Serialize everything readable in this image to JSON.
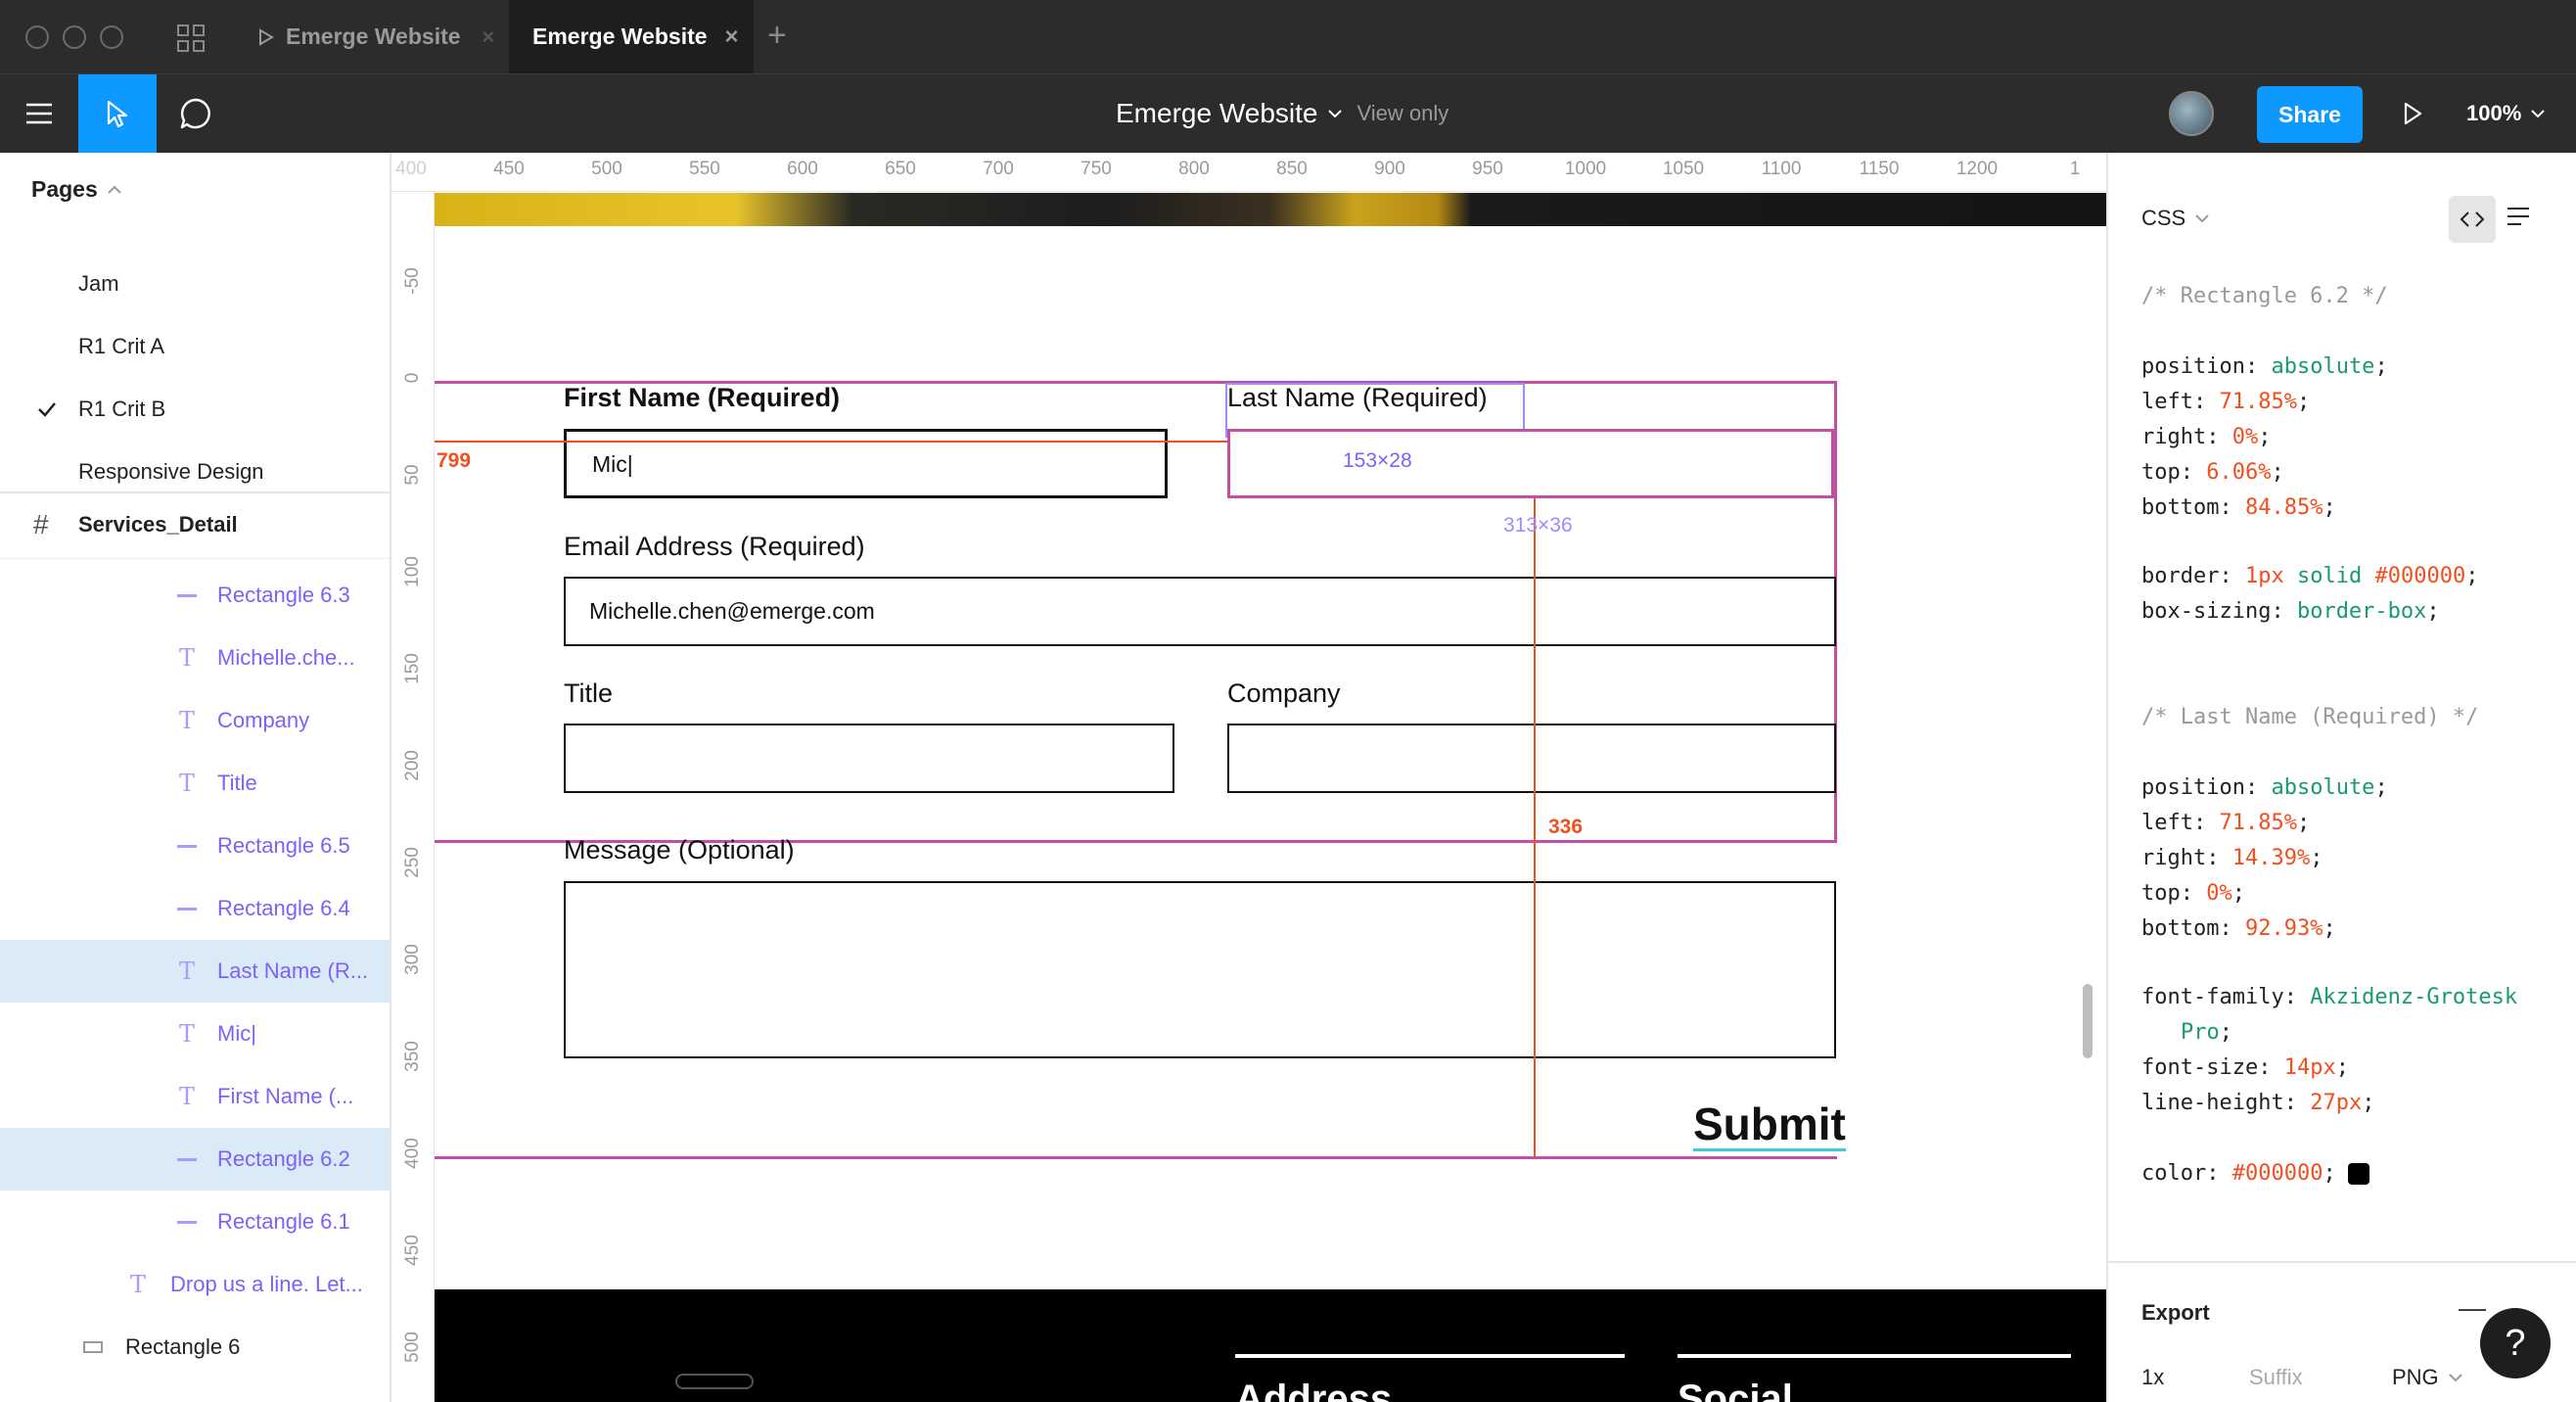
{
  "titlebar": {
    "tabs": [
      {
        "label": "Emerge Website",
        "active": false
      },
      {
        "label": "Emerge Website",
        "active": true
      }
    ]
  },
  "toolbar": {
    "file_name": "Emerge Website",
    "mode": "View only",
    "share_label": "Share",
    "zoom": "100%"
  },
  "pages": {
    "header": "Pages",
    "items": [
      {
        "label": "Jam",
        "current": false
      },
      {
        "label": "R1 Crit A",
        "current": false
      },
      {
        "label": "R1 Crit B",
        "current": true
      },
      {
        "label": "Responsive Design",
        "current": false
      }
    ]
  },
  "layers": {
    "frame": "Services_Detail",
    "items": [
      {
        "label": "Rectangle 6.3",
        "type": "line",
        "selected": false
      },
      {
        "label": "Michelle.che...",
        "type": "text",
        "selected": false
      },
      {
        "label": "Company",
        "type": "text",
        "selected": false
      },
      {
        "label": "Title",
        "type": "text",
        "selected": false
      },
      {
        "label": "Rectangle 6.5",
        "type": "line",
        "selected": false
      },
      {
        "label": "Rectangle 6.4",
        "type": "line",
        "selected": false
      },
      {
        "label": "Last Name (R...",
        "type": "text",
        "selected": true
      },
      {
        "label": "Mic|",
        "type": "text",
        "selected": false
      },
      {
        "label": "First Name (...",
        "type": "text",
        "selected": false
      },
      {
        "label": "Rectangle 6.2",
        "type": "line",
        "selected": true
      },
      {
        "label": "Rectangle 6.1",
        "type": "line",
        "selected": false
      },
      {
        "label": "Drop us a line. Let...",
        "type": "text",
        "selected": false
      },
      {
        "label": "Rectangle 6",
        "type": "rect",
        "selected": false
      }
    ]
  },
  "ruler_top": [
    "400",
    "450",
    "500",
    "550",
    "600",
    "650",
    "700",
    "750",
    "800",
    "850",
    "900",
    "950",
    "1000",
    "1050",
    "1100",
    "1150",
    "1200",
    "1"
  ],
  "ruler_left": [
    "-50",
    "0",
    "50",
    "100",
    "150",
    "200",
    "250",
    "300",
    "350",
    "400",
    "450",
    "500"
  ],
  "form": {
    "first_name_label": "First Name (Required)",
    "first_name_value": "Mic|",
    "last_name_label": "Last Name (Required)",
    "email_label": "Email Address (Required)",
    "email_value": "Michelle.chen@emerge.com",
    "title_label": "Title",
    "company_label": "Company",
    "message_label": "Message (Optional)",
    "submit_label": "Submit"
  },
  "footer": {
    "address_heading": "Address",
    "social_heading": "Social"
  },
  "measurements": {
    "dim_text": "153×28",
    "dim_rect": "313×36",
    "distance_left": "799",
    "distance_bottom": "336"
  },
  "inspect": {
    "tab": "CSS",
    "block1_comment": "/* Rectangle 6.2 */",
    "block1": [
      {
        "prop": "position",
        "val": "absolute",
        "kind": "kw"
      },
      {
        "prop": "left",
        "val": "71.85%",
        "kind": "num"
      },
      {
        "prop": "right",
        "val": "0%",
        "kind": "num"
      },
      {
        "prop": "top",
        "val": "6.06%",
        "kind": "num"
      },
      {
        "prop": "bottom",
        "val": "84.85%",
        "kind": "num"
      }
    ],
    "block1b": [
      {
        "prop": "border",
        "val": "1px solid #000000",
        "kind": "mixed"
      },
      {
        "prop": "box-sizing",
        "val": "border-box",
        "kind": "kw"
      }
    ],
    "block2_comment": "/* Last Name (Required) */",
    "block2": [
      {
        "prop": "position",
        "val": "absolute",
        "kind": "kw"
      },
      {
        "prop": "left",
        "val": "71.85%",
        "kind": "num"
      },
      {
        "prop": "right",
        "val": "14.39%",
        "kind": "num"
      },
      {
        "prop": "top",
        "val": "0%",
        "kind": "num"
      },
      {
        "prop": "bottom",
        "val": "92.93%",
        "kind": "num"
      }
    ],
    "font_family_prop": "font-family",
    "font_family_val1": "Akzidenz-Grotesk",
    "font_family_val2": "Pro",
    "font_size_prop": "font-size",
    "font_size_val": "14px",
    "line_height_prop": "line-height",
    "line_height_val": "27px",
    "color_prop": "color",
    "color_val": "#000000",
    "export_label": "Export",
    "export_scale": "1x",
    "export_suffix": "Suffix",
    "export_format": "PNG"
  },
  "colors": {
    "accent": "#0d99ff",
    "measure_red": "#f24e1e",
    "measure_purple": "#9747ff",
    "selection": "#daebf7"
  }
}
